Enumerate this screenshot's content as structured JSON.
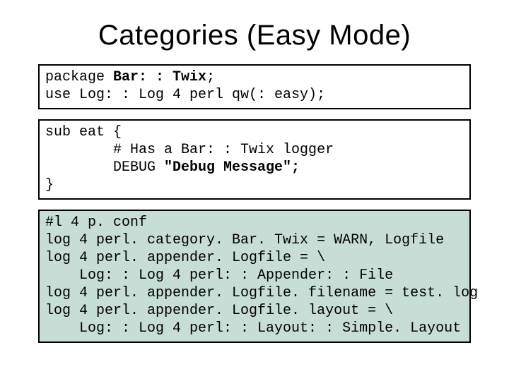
{
  "title": "Categories (Easy Mode)",
  "block1": {
    "l1a": "package ",
    "l1b": "Bar: : Twix",
    "l1c": ";",
    "l2": "use Log: : Log 4 perl qw(: easy);"
  },
  "block2": {
    "l1": "sub eat {",
    "l2": "        # Has a Bar: : Twix logger",
    "l3a": "        DEBUG ",
    "l3b": "\"Debug Message\";",
    "l4": "}"
  },
  "block3": {
    "l1": "#l 4 p. conf",
    "l2": "log 4 perl. category. Bar. Twix = WARN, Logfile",
    "l3": "log 4 perl. appender. Logfile = \\",
    "l4": "    Log: : Log 4 perl: : Appender: : File",
    "l5": "log 4 perl. appender. Logfile. filename = test. log",
    "l6": "log 4 perl. appender. Logfile. layout = \\",
    "l7": "    Log: : Log 4 perl: : Layout: : Simple. Layout"
  }
}
